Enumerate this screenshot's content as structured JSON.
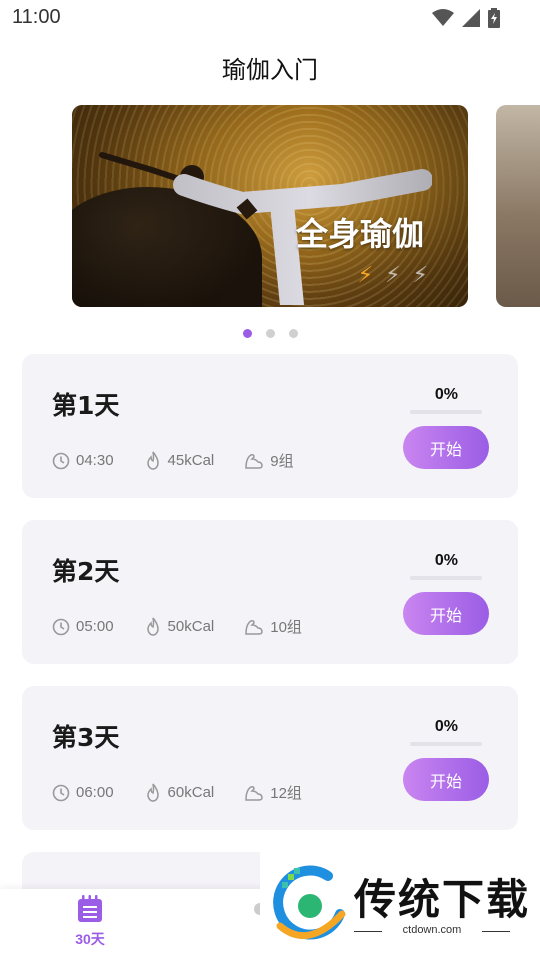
{
  "status_bar": {
    "time": "11:00"
  },
  "page": {
    "title": "瑜伽入门"
  },
  "banner": {
    "title": "全身瑜伽",
    "difficulty": {
      "level": 1,
      "max": 3
    },
    "dots": {
      "count": 3,
      "active": 0
    }
  },
  "days": [
    {
      "title": "第1天",
      "progress": "0%",
      "progress_value": 0,
      "duration": "04:30",
      "calories": "45kCal",
      "groups": "9组",
      "button": "开始"
    },
    {
      "title": "第2天",
      "progress": "0%",
      "progress_value": 0,
      "duration": "05:00",
      "calories": "50kCal",
      "groups": "10组",
      "button": "开始"
    },
    {
      "title": "第3天",
      "progress": "0%",
      "progress_value": 0,
      "duration": "06:00",
      "calories": "60kCal",
      "groups": "12组",
      "button": "开始"
    }
  ],
  "tabs": [
    {
      "label": "30天",
      "icon": "calendar-list-icon",
      "active": true
    }
  ],
  "watermark": {
    "title": "传统下载",
    "url": "ctdown.com"
  },
  "colors": {
    "accent": "#9b5de5",
    "card_bg": "#f4f3f8",
    "bolt_active": "#f5a623"
  }
}
